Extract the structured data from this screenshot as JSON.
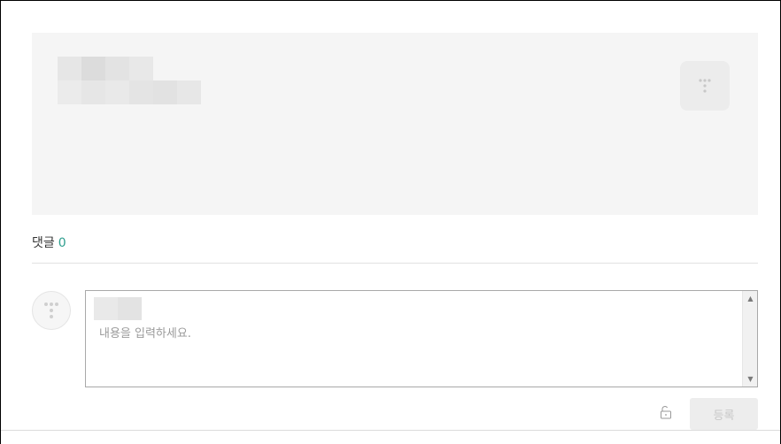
{
  "comments": {
    "label": "댓글",
    "count": "0",
    "accent_color": "#2e9e8e"
  },
  "editor": {
    "placeholder": "내용을 입력하세요."
  },
  "actions": {
    "submit_label": "등록"
  },
  "icons": {
    "card_logo": "tistory-logo-icon",
    "avatar": "tistory-avatar-icon",
    "lock": "unlock-icon",
    "scroll_up": "scroll-up-arrow-icon",
    "scroll_down": "scroll-down-arrow-icon"
  }
}
